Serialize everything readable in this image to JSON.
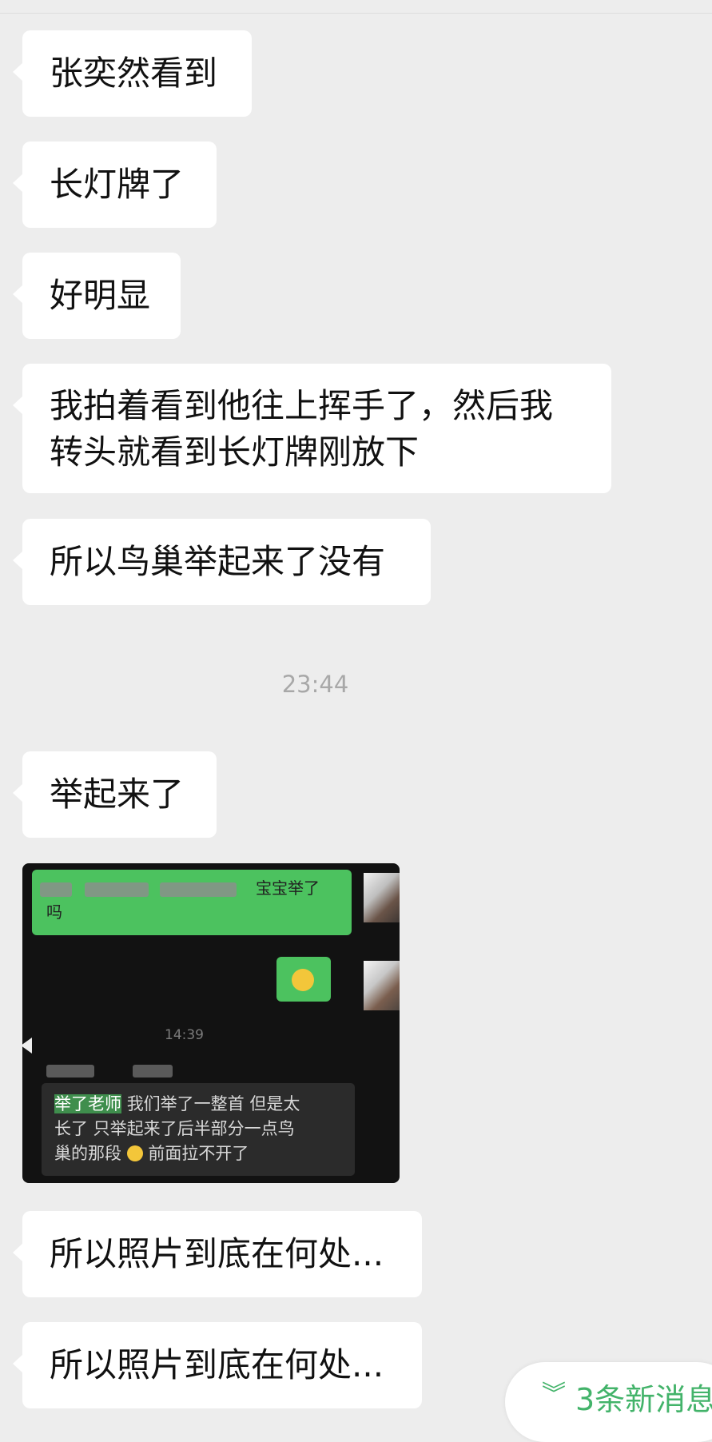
{
  "messages": [
    {
      "lines": [
        "张奕然看到"
      ]
    },
    {
      "lines": [
        "长灯牌了"
      ]
    },
    {
      "lines": [
        "好明显"
      ]
    },
    {
      "lines": [
        "我拍着看到他往上挥手了，然后我",
        "转头就看到长灯牌刚放下"
      ]
    },
    {
      "lines": [
        "所以鸟巢举起来了没有"
      ]
    },
    {
      "lines": [
        "举起来了"
      ]
    },
    {
      "lines": [
        "所以照片到底在何处..."
      ]
    },
    {
      "lines": [
        "所以照片到底在何处..."
      ]
    }
  ],
  "timestamp": "23:44",
  "image": {
    "top_msg_tail": "宝宝举了",
    "top_msg_line2": "吗",
    "time": "14:39",
    "quote_highlight": "举了老师",
    "quote_line1": "我们举了一整首 但是太",
    "quote_line2": "长了 只举起来了后半部分一点鸟",
    "quote_line3a": "巢的那段",
    "quote_line3b": "前面拉不开了"
  },
  "new_messages": {
    "chevron": "︾",
    "label": "3条新消息"
  },
  "colors": {
    "background": "#ededed",
    "bubble": "#ffffff",
    "accent_green": "#43b36a"
  }
}
